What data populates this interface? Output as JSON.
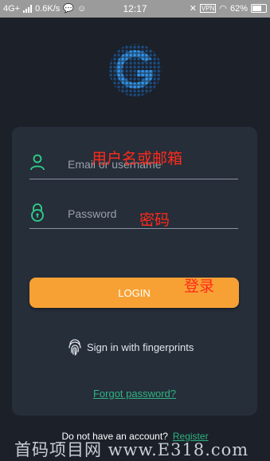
{
  "status_bar": {
    "network": "4G+",
    "speed": "0.6K/s",
    "time": "12:17",
    "vpn": "VPN",
    "battery": "62%"
  },
  "form": {
    "username_placeholder": "Email or username",
    "password_placeholder": "Password",
    "login_label": "LOGIN",
    "fingerprint_label": "Sign in with fingerprints",
    "forgot_label": "Forgot password?"
  },
  "annotations": {
    "username": "用户名或邮箱",
    "password": "密码",
    "login": "登录"
  },
  "footer": {
    "prompt": "Do not have an account?",
    "register": "Register"
  },
  "watermark": "首码项目网 www.E318.com",
  "colors": {
    "background": "#1b2029",
    "card": "#262e3a",
    "accent_orange": "#f7a134",
    "accent_green": "#2fb37f",
    "annotation_red": "#ff2a1a"
  },
  "icons": [
    "user-icon",
    "lock-icon",
    "fingerprint-icon",
    "app-logo"
  ]
}
